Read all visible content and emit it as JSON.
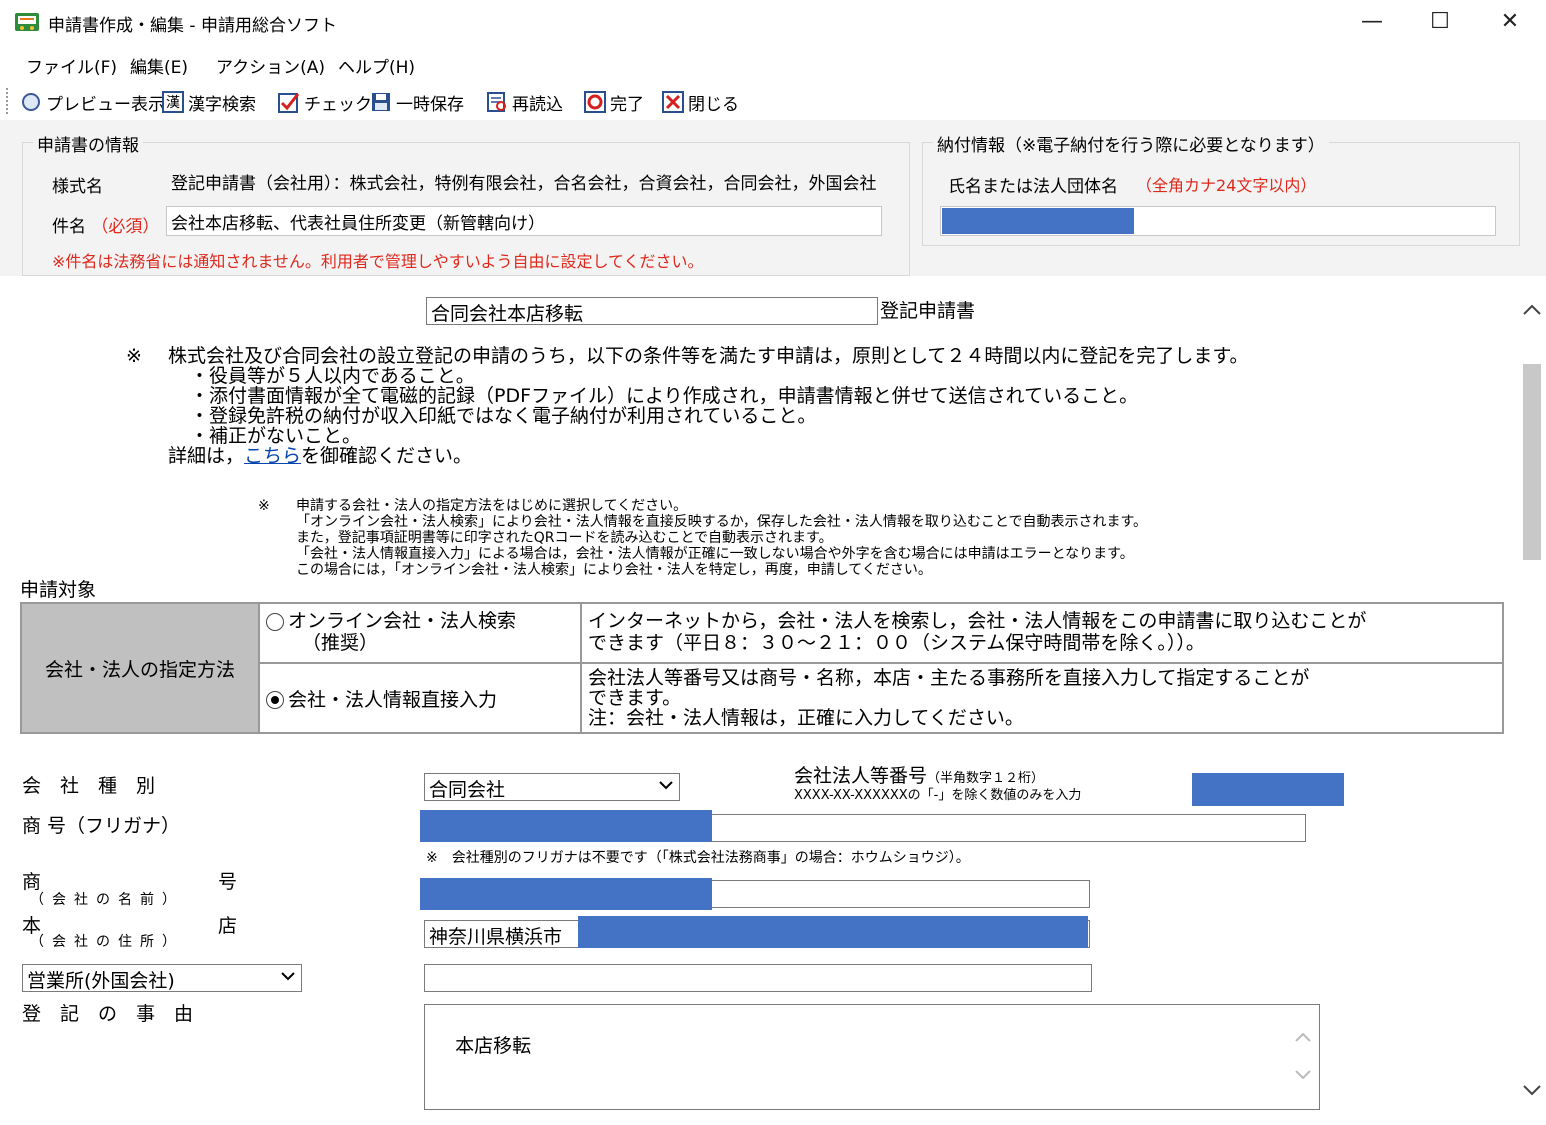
{
  "window": {
    "title": "申請書作成・編集 - 申請用総合ソフト",
    "minimize": "—",
    "maximize": "☐",
    "close": "✕"
  },
  "menu": [
    "ファイル(F)",
    "編集(E)",
    "アクション(A)",
    "ヘルプ(H)"
  ],
  "toolbar": {
    "preview": "プレビュー表示",
    "kanji": "漢字検索",
    "check": "チェック",
    "save": "一時保存",
    "reload": "再読込",
    "complete": "完了",
    "close": "閉じる"
  },
  "info": {
    "group_title": "申請書の情報",
    "form_name_label": "様式名",
    "form_name_value": "登記申請書（会社用）：株式会社，特例有限会社，合名会社，合資会社，合同会社，外国会社",
    "subject_label": "件名",
    "subject_required": "（必須）",
    "subject_value": "会社本店移転、代表社員住所変更（新管轄向け）",
    "note": "※件名は法務省には通知されません。利用者で管理しやすいよう自由に設定してください。"
  },
  "payment": {
    "group_title": "納付情報（※電子納付を行う際に必要となります）",
    "name_label": "氏名または法人団体名",
    "name_note": "（全角カナ24文字以内）"
  },
  "form": {
    "title_value": "合同会社本店移転",
    "title_suffix": "登記申請書",
    "notice_mark": "※",
    "notice_lines": [
      "株式会社及び合同会社の設立登記の申請のうち，以下の条件等を満たす申請は，原則として２４時間以内に登記を完了します。",
      "・役員等が５人以内であること。",
      "・添付書面情報が全て電磁的記録（PDFファイル）により作成され，申請書情報と併せて送信されていること。",
      "・登録免許税の納付が収入印紙ではなく電子納付が利用されていること。",
      "・補正がないこと。"
    ],
    "details_prefix": "詳細は，",
    "details_link": "こちら",
    "details_suffix": "を御確認ください。",
    "notice2_mark": "※",
    "notice2_lines": [
      "申請する会社・法人の指定方法をはじめに選択してください。",
      "「オンライン会社・法人検索」により会社・法人情報を直接反映するか，保存した会社・法人情報を取り込むことで自動表示されます。",
      "また，登記事項証明書等に印字されたQRコードを読み込むことで自動表示されます。",
      "「会社・法人情報直接入力」による場合は，会社・法人情報が正確に一致しない場合や外字を含む場合には申請はエラーとなります。",
      "この場合には，「オンライン会社・法人検索」により会社・法人を特定し，再度，申請してください。"
    ],
    "target_label": "申請対象",
    "method_label": "会社・法人の指定方法",
    "option1_label": "オンライン会社・法人検索",
    "option1_sub": "（推奨）",
    "option1_desc_1": "インターネットから，会社・法人を検索し，会社・法人情報をこの申請書に取り込むことが",
    "option1_desc_2": "できます（平日８：３０～２１：００（システム保守時間帯を除く。））。",
    "option2_label": "会社・法人情報直接入力",
    "option2_desc_1": "会社法人等番号又は商号・名称，本店・主たる事務所を直接入力して指定することが",
    "option2_desc_2": "できます。",
    "option2_desc_3": "注：会社・法人情報は，正確に入力してください。",
    "company_type_label": "会　社　種　別",
    "company_type_value": "合同会社",
    "corp_number_label": "会社法人等番号",
    "corp_number_hint": "（半角数字１２桁）",
    "corp_number_format": "XXXX-XX-XXXXXXの「-」を除く数値のみを入力",
    "trade_kana_label": "商 号（フリガナ）",
    "trade_kana_note": "※　会社種別のフリガナは不要です（「株式会社法務商事」の場合：ホウムショウジ）。",
    "trade_name_label_1": "商",
    "trade_name_label_2": "号",
    "trade_name_sub": "（会社の名前）",
    "head_office_label_1": "本",
    "head_office_label_2": "店",
    "head_office_sub": "（会社の住所）",
    "head_office_value": "神奈川県横浜市",
    "branch_select": "営業所(外国会社)",
    "reason_label": "登　記　の　事　由",
    "reason_value": "本店移転"
  },
  "colors": {
    "redact": "#4472c4",
    "required": "#e0281c",
    "link": "#0645ad"
  }
}
